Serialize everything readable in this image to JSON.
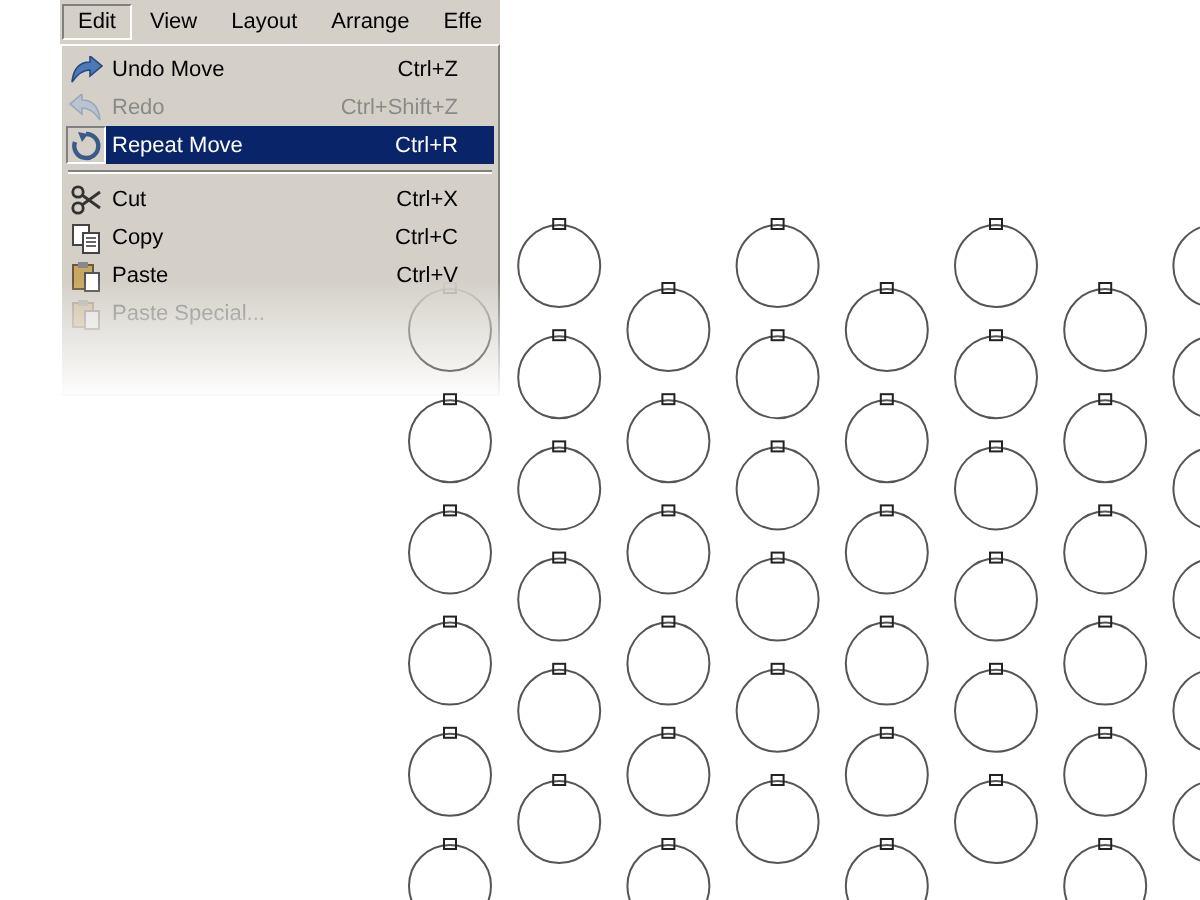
{
  "menubar": [
    {
      "label": "Edit",
      "selected": true
    },
    {
      "label": "View",
      "selected": false
    },
    {
      "label": "Layout",
      "selected": false
    },
    {
      "label": "Arrange",
      "selected": false
    },
    {
      "label": "Effe",
      "selected": false
    }
  ],
  "menu": [
    {
      "kind": "item",
      "label": "Undo Move",
      "shortcut": "Ctrl+Z",
      "disabled": false,
      "selected": false
    },
    {
      "kind": "item",
      "label": "Redo",
      "shortcut": "Ctrl+Shift+Z",
      "disabled": true,
      "selected": false
    },
    {
      "kind": "item",
      "label": "Repeat Move",
      "shortcut": "Ctrl+R",
      "disabled": false,
      "selected": true
    },
    {
      "kind": "separator"
    },
    {
      "kind": "item",
      "label": "Cut",
      "shortcut": "Ctrl+X",
      "disabled": false,
      "selected": false
    },
    {
      "kind": "item",
      "label": "Copy",
      "shortcut": "Ctrl+C",
      "disabled": false,
      "selected": false
    },
    {
      "kind": "item",
      "label": "Paste",
      "shortcut": "Ctrl+V",
      "disabled": false,
      "selected": false
    },
    {
      "kind": "item",
      "label": "Paste Special...",
      "disabled": true,
      "selected": false
    }
  ]
}
